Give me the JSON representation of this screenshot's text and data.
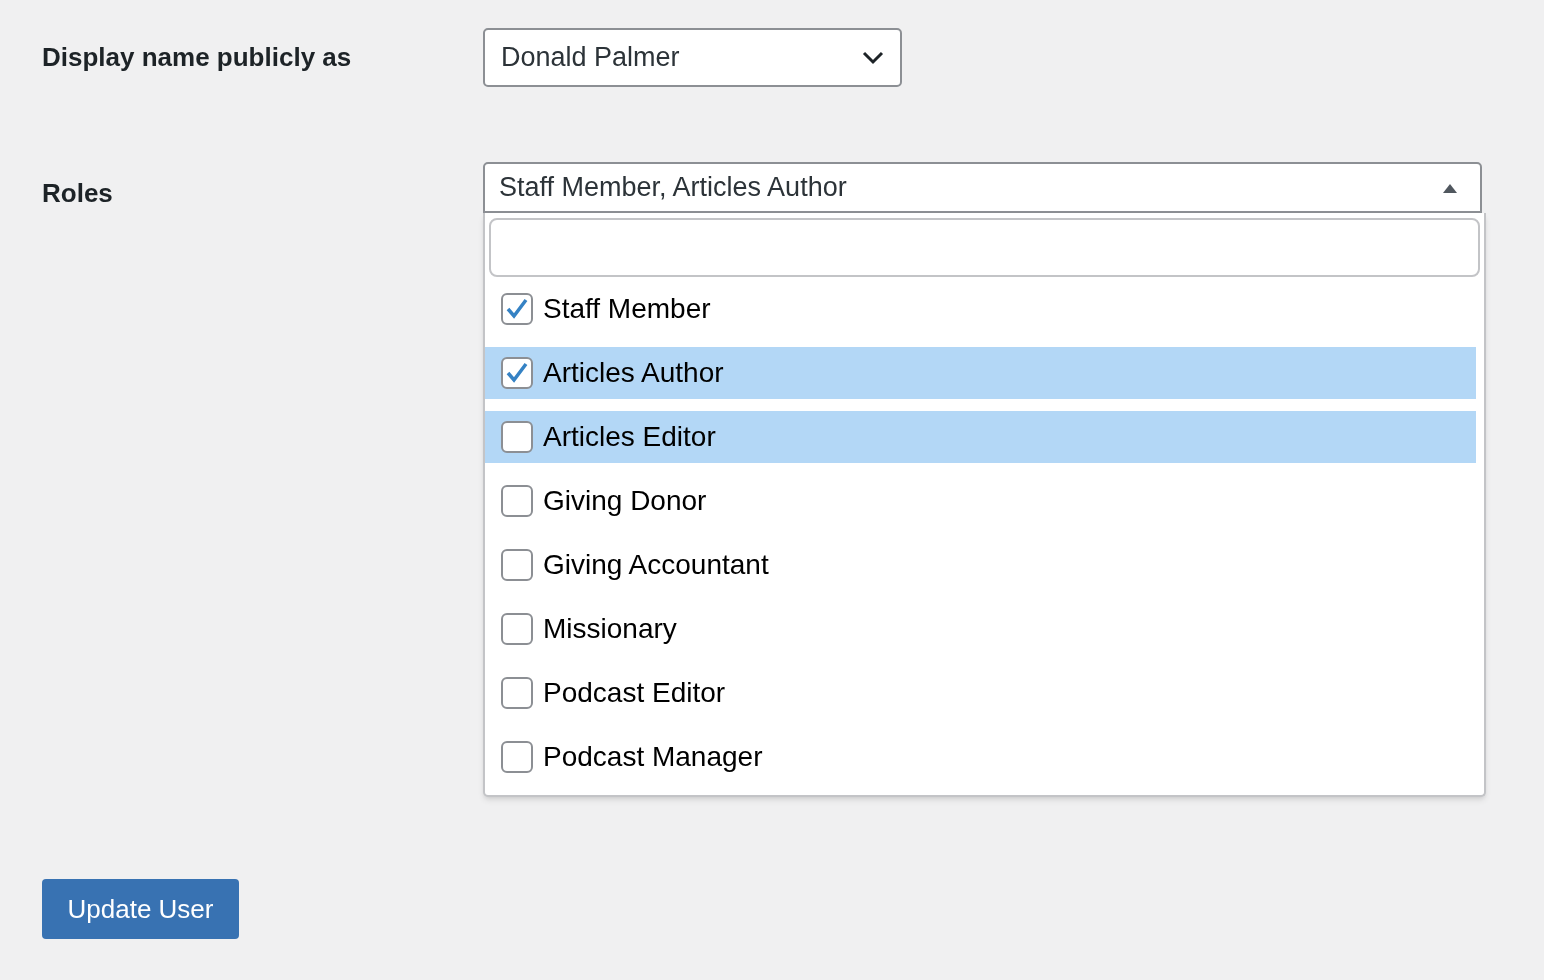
{
  "display_name": {
    "label": "Display name publicly as",
    "value": "Donald Palmer"
  },
  "roles": {
    "label": "Roles",
    "value": "Staff Member, Articles Author",
    "expanded": true,
    "options": [
      {
        "label": "Staff Member",
        "checked": true,
        "highlighted": false
      },
      {
        "label": "Articles Author",
        "checked": true,
        "highlighted": true
      },
      {
        "label": "Articles Editor",
        "checked": false,
        "highlighted": true
      },
      {
        "label": "Giving Donor",
        "checked": false,
        "highlighted": false
      },
      {
        "label": "Giving Accountant",
        "checked": false,
        "highlighted": false
      },
      {
        "label": "Missionary",
        "checked": false,
        "highlighted": false
      },
      {
        "label": "Podcast Editor",
        "checked": false,
        "highlighted": false
      },
      {
        "label": "Podcast Manager",
        "checked": false,
        "highlighted": false
      }
    ]
  },
  "submit": {
    "label": "Update User"
  }
}
